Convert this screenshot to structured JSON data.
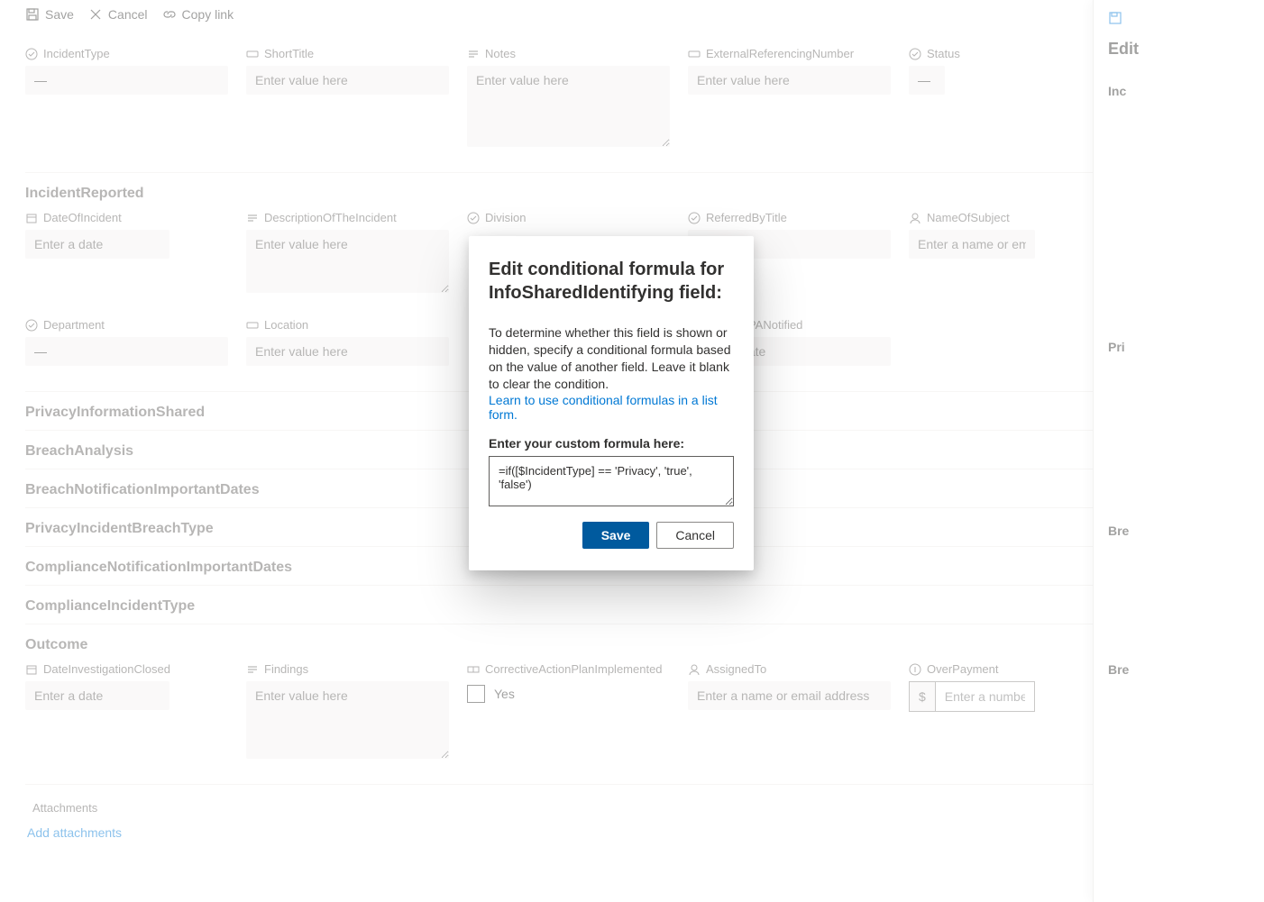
{
  "toolbar": {
    "save": "Save",
    "cancel": "Cancel",
    "copylink": "Copy link"
  },
  "fields": {
    "incidentType": {
      "label": "IncidentType",
      "value": "—"
    },
    "shortTitle": {
      "label": "ShortTitle",
      "placeholder": "Enter value here"
    },
    "notes": {
      "label": "Notes",
      "placeholder": "Enter value here"
    },
    "extRef": {
      "label": "ExternalReferencingNumber",
      "placeholder": "Enter value here"
    },
    "status": {
      "label": "Status",
      "value": "—"
    },
    "dateOfIncident": {
      "label": "DateOfIncident",
      "placeholder": "Enter a date"
    },
    "descIncident": {
      "label": "DescriptionOfTheIncident",
      "placeholder": "Enter value here"
    },
    "division": {
      "label": "Division"
    },
    "referredByTitle": {
      "label": "ReferredByTitle",
      "value": "—"
    },
    "nameOfSubject": {
      "label": "NameOfSubject",
      "placeholder": "Enter a name or email"
    },
    "department": {
      "label": "Department",
      "value": "—"
    },
    "location": {
      "label": "Location",
      "placeholder": "Enter value here"
    },
    "dateOCPA": {
      "label": "DateOCPANotified",
      "placeholder": "Enter a date"
    },
    "dateInvClosed": {
      "label": "DateInvestigationClosed",
      "placeholder": "Enter a date"
    },
    "findings": {
      "label": "Findings",
      "placeholder": "Enter value here"
    },
    "corrective": {
      "label": "CorrectiveActionPlanImplemented",
      "option": "Yes"
    },
    "assignedTo": {
      "label": "AssignedTo",
      "placeholder": "Enter a name or email address"
    },
    "overPayment": {
      "label": "OverPayment",
      "currency": "$",
      "placeholder": "Enter a number"
    },
    "attachments": {
      "label": "Attachments",
      "add": "Add attachments"
    }
  },
  "sections": {
    "incidentReported": "IncidentReported",
    "privacyInfoShared": "PrivacyInformationShared",
    "breachAnalysis": "BreachAnalysis",
    "breachDates": "BreachNotificationImportantDates",
    "privacyBreachType": "PrivacyIncidentBreachType",
    "complianceDates": "ComplianceNotificationImportantDates",
    "complianceType": "ComplianceIncidentType",
    "outcome": "Outcome"
  },
  "sidePanel": {
    "title": "Edit",
    "inc": "Inc",
    "pri": "Pri",
    "bre1": "Bre",
    "bre2": "Bre"
  },
  "dialog": {
    "title": "Edit conditional formula for InfoSharedIdentifying field:",
    "desc": "To determine whether this field is shown or hidden, specify a conditional formula based on the value of another field. Leave it blank to clear the condition.",
    "link": "Learn to use conditional formulas in a list form.",
    "inputLabel": "Enter your custom formula here:",
    "formula": "=if([$IncidentType] == 'Privacy', 'true', 'false')",
    "save": "Save",
    "cancel": "Cancel"
  }
}
